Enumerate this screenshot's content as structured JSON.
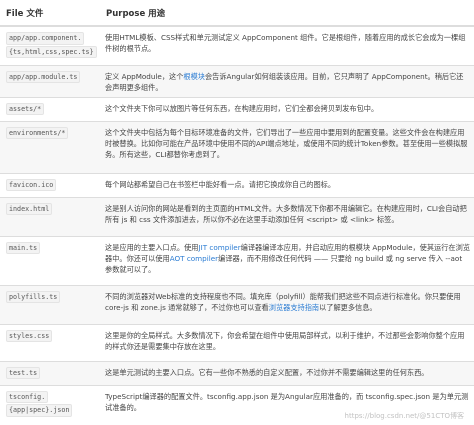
{
  "header": {
    "file_col": "File 文件",
    "purpose_col": "Purpose 用途"
  },
  "rows": [
    {
      "file": [
        "app/app.component.",
        "{ts,html,css,spec.ts}"
      ],
      "desc": "使用HTML模板、CSS样式和单元测试定义 AppComponent 组件。它是根组件，随着应用的成长它会成为一棵组件树的根节点。"
    },
    {
      "file": [
        "app/app.module.ts"
      ],
      "desc_pre": "定义 AppModule，这个",
      "desc_link": "根模块",
      "desc_post": "会告诉Angular如何组装该应用。目前，它只声明了 AppComponent。稍后它还会声明更多组件。"
    },
    {
      "file": [
        "assets/*"
      ],
      "desc": "这个文件夹下你可以放图片等任何东西，在构建应用时，它们全都会拷贝到发布包中。"
    },
    {
      "file": [
        "environments/*"
      ],
      "desc": "这个文件夹中包括为每个目标环境准备的文件，它们导出了一些应用中要用到的配置变量。这些文件会在构建应用时被替换。比如你可能在产品环境中使用不同的API端点地址，或使用不同的统计Token参数。甚至使用一些模拟服务。所有这些，CLI都替你考虑到了。"
    },
    {
      "file": [
        "favicon.ico"
      ],
      "desc": "每个网站都希望自己在书签栏中能好看一点。请把它换成你自己的图标。"
    },
    {
      "file": [
        "index.html"
      ],
      "desc": "这是别人访问你的网站是看到的主页面的HTML文件。大多数情况下你都不用编辑它。在构建应用时，CLI会自动把所有 js 和 css 文件添加进去，所以你不必在这里手动添加任何 <script> 或 <link> 标签。"
    },
    {
      "file": [
        "main.ts"
      ],
      "desc_pre": "这是应用的主要入口点。使用",
      "desc_link": "JIT compiler",
      "desc_mid": "编译器编译本应用，并启动应用的根模块 AppModule，使其运行在浏览器中。你还可以使用",
      "desc_link2": "AOT compiler",
      "desc_post": "编译器，而不用修改任何代码 —— 只要给 ng build 或 ng serve 传入 --aot 参数就可以了。"
    },
    {
      "file": [
        "polyfills.ts"
      ],
      "desc_pre": "不同的浏览器对Web标准的支持程度也不同。填充库（polyfill）能帮我们把这些不同点进行标准化。你只要使用 core-js 和 zone.js 通常就够了，不过你也可以查看",
      "desc_link": "浏览器支持指南",
      "desc_post": "以了解更多信息。"
    },
    {
      "file": [
        "styles.css"
      ],
      "desc": "这里是你的全局样式。大多数情况下，你会希望在组件中使用局部样式，以利于维护，不过那些会影响你整个应用的样式你还是需要集中存放在这里。"
    },
    {
      "file": [
        "test.ts"
      ],
      "desc": "这是单元测试的主要入口点。它有一些你不熟悉的自定义配置，不过你并不需要编辑这里的任何东西。"
    },
    {
      "file": [
        "tsconfig.",
        "{app|spec}.json"
      ],
      "desc": "TypeScript编译器的配置文件。tsconfig.app.json 是为Angular应用准备的，而 tsconfig.spec.json 是为单元测试准备的。"
    }
  ],
  "watermark": "https://blog.csdn.net/@51CTO博客"
}
